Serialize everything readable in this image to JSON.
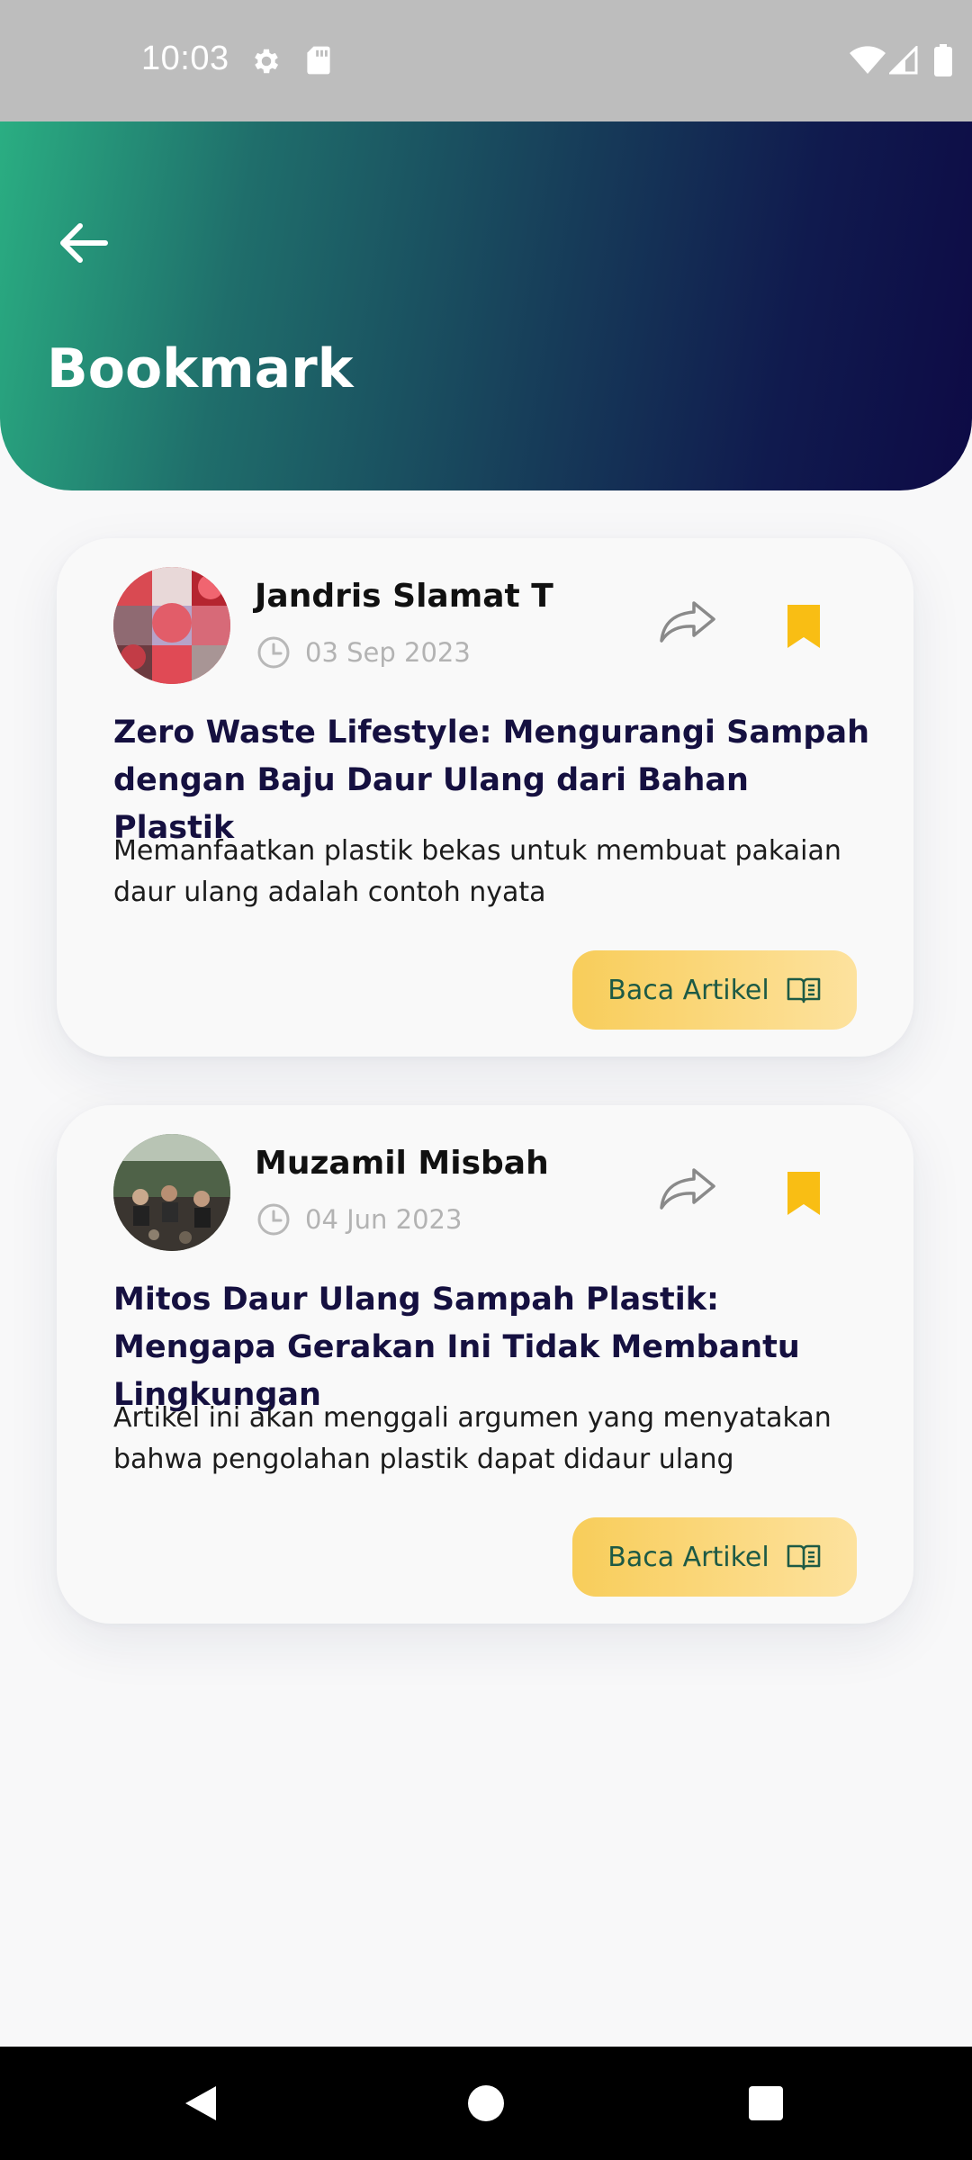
{
  "status_bar": {
    "time": "10:03",
    "icons": [
      "settings-icon",
      "sd-card-icon",
      "wifi-icon",
      "signal-icon",
      "battery-icon"
    ]
  },
  "header": {
    "title": "Bookmark",
    "back_icon": "arrow-left-icon",
    "gradient_colors": [
      "#2aae82",
      "#173f5a",
      "#0d0a45"
    ]
  },
  "articles": [
    {
      "author": "Jandris Slamat T",
      "date": "03 Sep 2023",
      "title": "Zero Waste Lifestyle: Mengurangi Sampah dengan Baju Daur Ulang dari Bahan Plastik",
      "description": "Memanfaatkan plastik bekas untuk membuat pakaian daur ulang adalah contoh nyata",
      "read_label": "Baca Artikel",
      "bookmarked": true
    },
    {
      "author": "Muzamil Misbah",
      "date": "04 Jun 2023",
      "title": "Mitos Daur Ulang Sampah Plastik: Mengapa Gerakan Ini Tidak Membantu Lingkungan",
      "description": "Artikel ini akan menggali argumen yang menyatakan bahwa pengolahan plastik dapat didaur ulang",
      "read_label": "Baca Artikel",
      "bookmarked": true
    }
  ],
  "colors": {
    "bookmark": "#f9be14",
    "title_text": "#151040",
    "button_text": "#1d5a45",
    "button_gradient": [
      "#f8cd5a",
      "#fde29e"
    ]
  },
  "nav_bar": {
    "buttons": [
      "nav-back-icon",
      "nav-home-icon",
      "nav-recents-icon"
    ]
  }
}
